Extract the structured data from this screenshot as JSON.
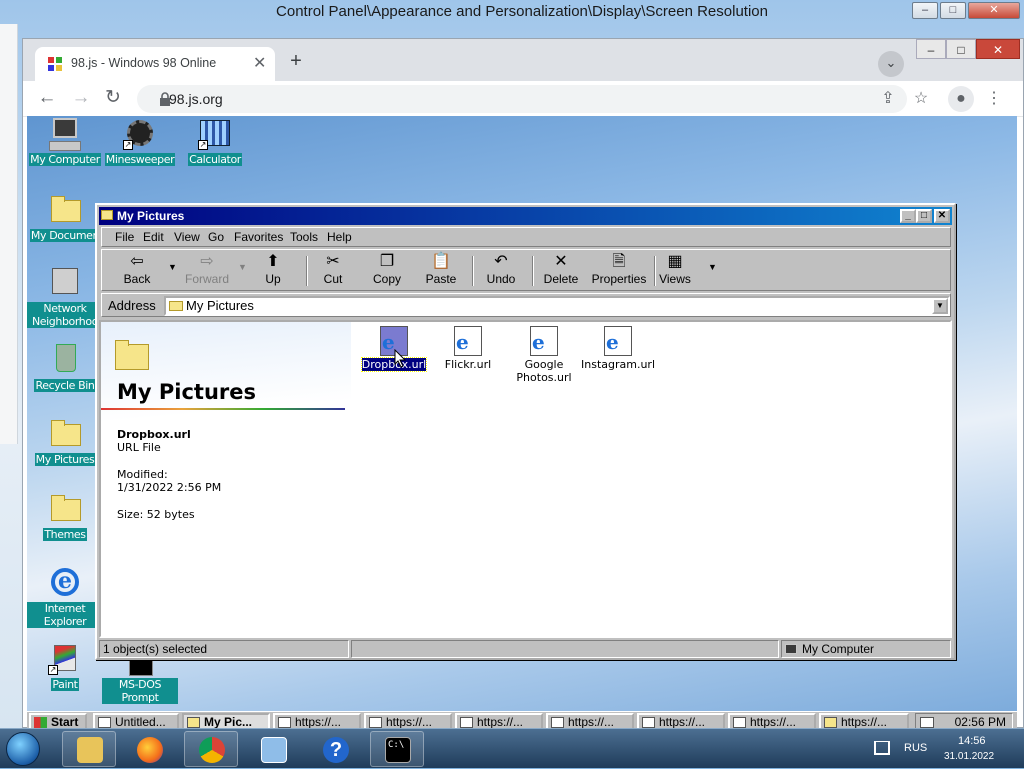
{
  "host": {
    "title": "Control Panel\\Appearance and Personalization\\Display\\Screen Resolution",
    "controls": [
      "–",
      "□",
      "✕"
    ]
  },
  "chrome": {
    "tab_title": "98.js - Windows 98 Online",
    "tab_close": "✕",
    "new_tab": "+",
    "tab_search": "⌄",
    "url": "98.js.org",
    "window_controls": {
      "min": "–",
      "max": "□",
      "close": "✕"
    },
    "nav": {
      "back": "←",
      "forward": "→",
      "reload": "↻"
    },
    "right_icons": {
      "share": "⇪",
      "star": "☆",
      "profile": "●",
      "menu": "⋮"
    }
  },
  "desktop_icons": [
    {
      "label": "My Computer",
      "icon": "my-computer-icon"
    },
    {
      "label": "Minesweeper",
      "icon": "minesweeper-icon"
    },
    {
      "label": "Calculator",
      "icon": "calculator-icon"
    },
    {
      "label": "My Documen",
      "icon": "my-documents-icon"
    },
    {
      "label": "Network Neighborhoo",
      "icon": "network-icon"
    },
    {
      "label": "Recycle Bin",
      "icon": "recycle-bin-icon"
    },
    {
      "label": "My Pictures",
      "icon": "folder-icon"
    },
    {
      "label": "Themes",
      "icon": "folder-icon"
    },
    {
      "label": "Internet Explorer",
      "icon": "ie-icon"
    },
    {
      "label": "Paint",
      "icon": "paint-icon"
    },
    {
      "label": "MS-DOS Prompt",
      "icon": "msdos-icon"
    }
  ],
  "explorer": {
    "title": "My Pictures",
    "menu": [
      "File",
      "Edit",
      "View",
      "Go",
      "Favorites",
      "Tools",
      "Help"
    ],
    "toolbar": {
      "back": "Back",
      "forward": "Forward",
      "up": "Up",
      "cut": "Cut",
      "copy": "Copy",
      "paste": "Paste",
      "undo": "Undo",
      "delete": "Delete",
      "properties": "Properties",
      "views": "Views"
    },
    "address_label": "Address",
    "address_value": "My Pictures",
    "webview": {
      "title": "My Pictures",
      "file_name": "Dropbox.url",
      "file_type": "URL File",
      "modified_label": "Modified:",
      "modified_value": "1/31/2022 2:56 PM",
      "size": "Size: 52 bytes"
    },
    "files": [
      {
        "label": "Dropbox.url",
        "selected": true
      },
      {
        "label": "Flickr.url",
        "selected": false
      },
      {
        "label": "Google Photos.url",
        "selected": false
      },
      {
        "label": "Instagram.url",
        "selected": false
      }
    ],
    "status_left": "1 object(s) selected",
    "status_right": "My Computer"
  },
  "taskbar98": {
    "start": "Start",
    "buttons": [
      "Untitled...",
      "My Pic...",
      "https://...",
      "https://...",
      "https://...",
      "https://...",
      "https://...",
      "https://...",
      "https://..."
    ],
    "clock": "02:56 PM"
  },
  "taskbar7": {
    "lang": "RUS",
    "time": "14:56",
    "date": "31.01.2022"
  }
}
